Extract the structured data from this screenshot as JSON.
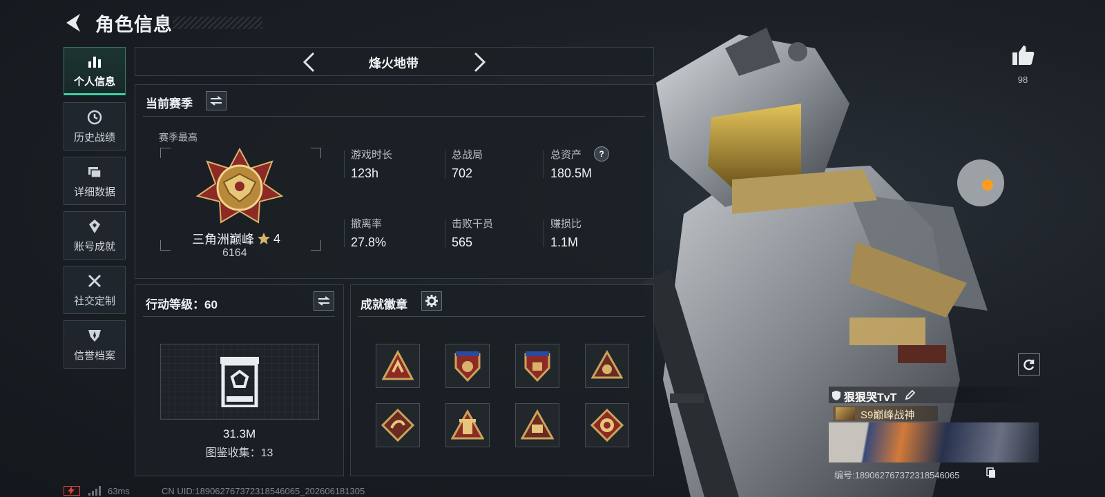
{
  "header": {
    "title": "角色信息"
  },
  "sidebar": {
    "items": [
      {
        "label": "个人信息",
        "icon": "bar-chart-icon",
        "active": true
      },
      {
        "label": "历史战绩",
        "icon": "clock-icon"
      },
      {
        "label": "详细数据",
        "icon": "folder-icon"
      },
      {
        "label": "账号成就",
        "icon": "achievement-icon"
      },
      {
        "label": "社交定制",
        "icon": "tools-icon"
      },
      {
        "label": "信誉档案",
        "icon": "shield-icon"
      }
    ]
  },
  "mode": {
    "name": "烽火地带"
  },
  "season": {
    "title": "当前赛季",
    "best_label": "赛季最高",
    "rank_name": "三角洲巅峰",
    "rank_stars": "4",
    "rank_points": "6164",
    "stats": [
      {
        "label": "游戏时长",
        "value": "123h"
      },
      {
        "label": "总战局",
        "value": "702"
      },
      {
        "label": "总资产",
        "value": "180.5M",
        "help": "?"
      },
      {
        "label": "撤离率",
        "value": "27.8%"
      },
      {
        "label": "击败干员",
        "value": "565"
      },
      {
        "label": "赚损比",
        "value": "1.1M"
      }
    ]
  },
  "action_level": {
    "title": "行动等级：60",
    "value": "31.3M",
    "collection": "图鉴收集：13"
  },
  "achievements": {
    "title": "成就徽章"
  },
  "likes": {
    "count": "98"
  },
  "profile": {
    "name": "狠狠哭TvT",
    "title_badge": "S9巅峰战神",
    "id_text": "编号:1890627673723185460​65"
  },
  "footer": {
    "ping": "63ms",
    "uid": "CN UID:18906276737​2318546065_202606181305"
  },
  "colors": {
    "accent": "#3bd3a0",
    "gold": "#c9a45a",
    "badge_red": "#8e2a25"
  }
}
